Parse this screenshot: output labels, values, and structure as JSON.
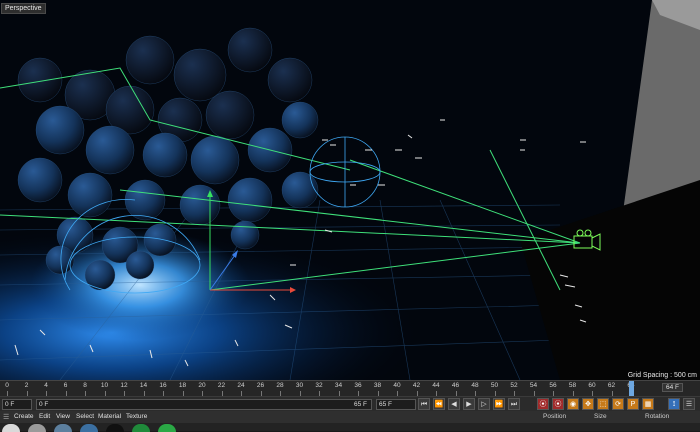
{
  "viewport": {
    "label": "Perspective",
    "grid_spacing": "Grid Spacing : 500 cm"
  },
  "timeline": {
    "ticks": [
      "0",
      "2",
      "4",
      "6",
      "8",
      "10",
      "12",
      "14",
      "16",
      "18",
      "20",
      "22",
      "24",
      "26",
      "28",
      "30",
      "32",
      "34",
      "36",
      "38",
      "40",
      "42",
      "44",
      "46",
      "48",
      "50",
      "52",
      "54",
      "56",
      "58",
      "60",
      "62",
      "64"
    ],
    "current_frame": "64 F",
    "playhead_frame": 64
  },
  "transport": {
    "start_field": "0 F",
    "current_field": "0 F",
    "end_field": "65 F",
    "max_field": "65 F",
    "buttons": [
      {
        "icon": "goto-start-icon",
        "glyph": "⏮"
      },
      {
        "icon": "prev-key-icon",
        "glyph": "⏪"
      },
      {
        "icon": "step-back-icon",
        "glyph": "◀"
      },
      {
        "icon": "play-icon",
        "glyph": "▶"
      },
      {
        "icon": "step-forward-icon",
        "glyph": "▷"
      },
      {
        "icon": "next-key-icon",
        "glyph": "⏩"
      },
      {
        "icon": "goto-end-icon",
        "glyph": "⏭"
      }
    ],
    "key_buttons": [
      {
        "icon": "record-icon",
        "glyph": "⦿",
        "style": "red"
      },
      {
        "icon": "autokey-icon",
        "glyph": "⦿",
        "style": "red"
      },
      {
        "icon": "keyframe-selection-icon",
        "glyph": "◉",
        "style": "orange"
      },
      {
        "icon": "position-key-icon",
        "glyph": "✥",
        "style": "orange"
      },
      {
        "icon": "scale-key-icon",
        "glyph": "⬚",
        "style": "orange"
      },
      {
        "icon": "rotation-key-icon",
        "glyph": "⟳",
        "style": "orange"
      },
      {
        "icon": "parameter-key-icon",
        "glyph": "P",
        "style": "orange"
      },
      {
        "icon": "pla-key-icon",
        "glyph": "▦",
        "style": "orange"
      }
    ],
    "right_buttons": [
      {
        "icon": "motion-icon",
        "glyph": "⟟",
        "style": "blue"
      },
      {
        "icon": "timeline-menu-icon",
        "glyph": "☰",
        "style": ""
      }
    ]
  },
  "menubar": {
    "items": [
      "Create",
      "Edit",
      "View",
      "Select",
      "Material",
      "Texture"
    ]
  },
  "attributes": {
    "headers": [
      "Position",
      "Size",
      "Rotation"
    ]
  },
  "materials": {
    "swatch_colors": [
      "#d9d9d9",
      "#9a9a9a",
      "#5c7f9e",
      "#3b6fa1",
      "#101010",
      "#1f8a3a",
      "#2aa845"
    ]
  },
  "colors": {
    "spline_green": "#3fe07a",
    "light_cyan": "#3fa9f5",
    "axis_red": "#e84a3a",
    "axis_green": "#35e060",
    "axis_blue": "#3a7ce8",
    "camera_green": "#7dff5a"
  }
}
